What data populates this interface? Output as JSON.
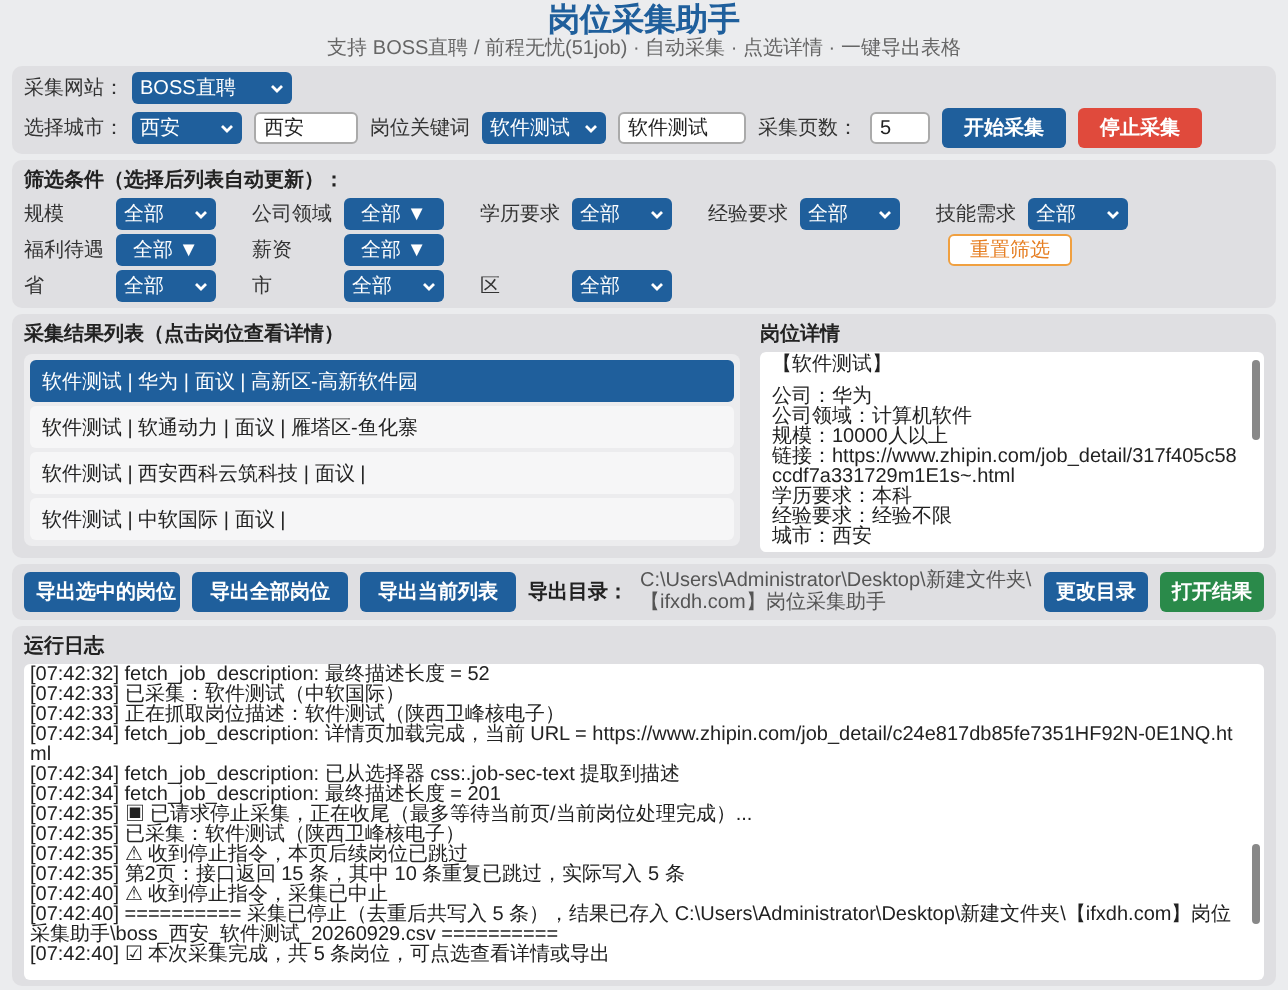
{
  "header": {
    "title": "岗位采集助手",
    "subtitle": "支持 BOSS直聘 / 前程无忧(51job) · 自动采集 · 点选详情 · 一键导出表格"
  },
  "source_panel": {
    "site": {
      "label": "采集网站：",
      "value": "BOSS直聘"
    },
    "city": {
      "label": "选择城市：",
      "value": "西安",
      "input": "西安"
    },
    "keyword": {
      "label": "岗位关键词",
      "value": "软件测试",
      "input": "软件测试"
    },
    "pages": {
      "label": "采集页数：",
      "value": "5"
    },
    "buttons": [
      {
        "label": "开始采集",
        "kind": "primary"
      },
      {
        "label": "停止采集",
        "kind": "danger"
      }
    ]
  },
  "filters": {
    "title": "筛选条件（选择后列表自动更新）：",
    "rows": [
      [
        {
          "label": "规模",
          "value": "全部",
          "kind": "dropdown"
        },
        {
          "label": "公司领域",
          "value": "全部 ▼",
          "kind": "menu"
        },
        {
          "label": "学历要求",
          "value": "全部",
          "kind": "dropdown"
        },
        {
          "label": "经验要求",
          "value": "全部",
          "kind": "dropdown"
        },
        {
          "label": "技能需求",
          "value": "全部",
          "kind": "dropdown"
        }
      ],
      [
        {
          "label": "福利待遇",
          "value": "全部 ▼",
          "kind": "menu"
        },
        {
          "label": "薪资",
          "value": "全部 ▼",
          "kind": "menu"
        }
      ],
      [
        {
          "label": "省",
          "value": "全部",
          "kind": "dropdown"
        },
        {
          "label": "市",
          "value": "全部",
          "kind": "dropdown"
        },
        {
          "label": "区",
          "value": "全部",
          "kind": "dropdown"
        }
      ]
    ],
    "reset_button": "重置筛选"
  },
  "results": {
    "title": "采集结果列表（点击岗位查看详情）",
    "items": [
      {
        "text": "软件测试 | 华为 | 面议 | 高新区-高新软件园",
        "selected": true
      },
      {
        "text": "软件测试 | 软通动力 | 面议 | 雁塔区-鱼化寨",
        "selected": false
      },
      {
        "text": "软件测试 | 西安西科云筑科技 | 面议 |",
        "selected": false
      },
      {
        "text": "软件测试 | 中软国际 | 面议 |",
        "selected": false
      }
    ]
  },
  "details": {
    "title": "岗位详情",
    "lines": [
      "【软件测试】",
      "公司：华为",
      "公司领域：计算机软件",
      "规模：10000人以上",
      "链接：https://www.zhipin.com/job_detail/317f405c58ccdf7a331729m1E1s~.html",
      "学历要求：本科",
      "经验要求：经验不限",
      "城市：西安"
    ]
  },
  "export": {
    "buttons": [
      "导出选中的岗位",
      "导出全部岗位",
      "导出当前列表"
    ],
    "dir_label": "导出目录：",
    "dir_path": "C:\\Users\\Administrator\\Desktop\\新建文件夹\\【ifxdh.com】岗位采集助手",
    "change_button": "更改目录",
    "open_button": "打开结果"
  },
  "log": {
    "title": "运行日志",
    "lines": [
      {
        "time": "[07:42:32]",
        "text": "fetch_job_description: 最终描述长度 = 52"
      },
      {
        "time": "[07:42:33]",
        "text": "已采集：软件测试（中软国际）"
      },
      {
        "time": "[07:42:33]",
        "text": "正在抓取岗位描述：软件测试（陕西卫峰核电子）"
      },
      {
        "time": "[07:42:34]",
        "text": "fetch_job_description: 详情页加载完成，当前 URL = https://www.zhipin.com/job_detail/c24e817db85fe7351HF92N-0E1NQ.html"
      },
      {
        "time": "[07:42:34]",
        "text": "fetch_job_description: 已从选择器 css:.job-sec-text 提取到描述"
      },
      {
        "time": "[07:42:34]",
        "text": "fetch_job_description: 最终描述长度 = 201"
      },
      {
        "time": "[07:42:35]",
        "text": "▣ 已请求停止采集，正在收尾（最多等待当前页/当前岗位处理完成）..."
      },
      {
        "time": "[07:42:35]",
        "text": "已采集：软件测试（陕西卫峰核电子）"
      },
      {
        "time": "[07:42:35]",
        "text": "⚠ 收到停止指令，本页后续岗位已跳过"
      },
      {
        "time": "[07:42:35]",
        "text": "第2页：接口返回 15 条，其中 10 条重复已跳过，实际写入 5 条"
      },
      {
        "time": "[07:42:40]",
        "text": "⚠ 收到停止指令，采集已中止"
      },
      {
        "time": "[07:42:40]",
        "text": "========== 采集已停止（去重后共写入 5 条），结果已存入 C:\\Users\\Administrator\\Desktop\\新建文件夹\\【ifxdh.com】岗位采集助手\\boss_西安_软件测试_20260929.csv =========="
      },
      {
        "time": "[07:42:40]",
        "text": "☑ 本次采集完成，共 5 条岗位，可点选查看详情或导出"
      }
    ]
  }
}
